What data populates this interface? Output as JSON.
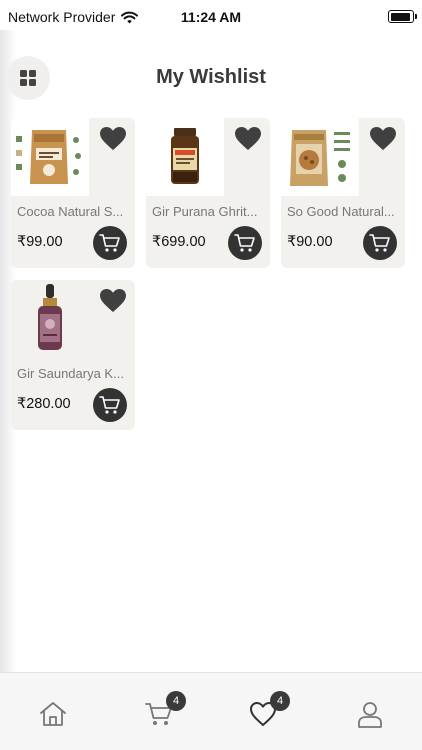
{
  "status_bar": {
    "carrier": "Network Provider",
    "time": "11:24 AM"
  },
  "header": {
    "title": "My Wishlist",
    "menu_icon": "grid-icon"
  },
  "products": [
    {
      "name": "Cocoa Natural S...",
      "price": "₹99.00",
      "image": "pouch"
    },
    {
      "name": "Gir Purana Ghrit...",
      "price": "₹699.00",
      "image": "jar"
    },
    {
      "name": "So Good Natural...",
      "price": "₹90.00",
      "image": "pouch"
    },
    {
      "name": "Gir Saundarya K...",
      "price": "₹280.00",
      "image": "dropper-bottle"
    }
  ],
  "bottom_nav": {
    "items": [
      {
        "icon": "home-icon"
      },
      {
        "icon": "cart-icon",
        "badge": "4"
      },
      {
        "icon": "heart-icon",
        "badge": "4"
      },
      {
        "icon": "profile-icon"
      }
    ]
  },
  "colors": {
    "card_bg": "#f2f1ee",
    "dark": "#333333",
    "title": "#3a3a3a",
    "nav_bg": "#f6f6f6"
  }
}
